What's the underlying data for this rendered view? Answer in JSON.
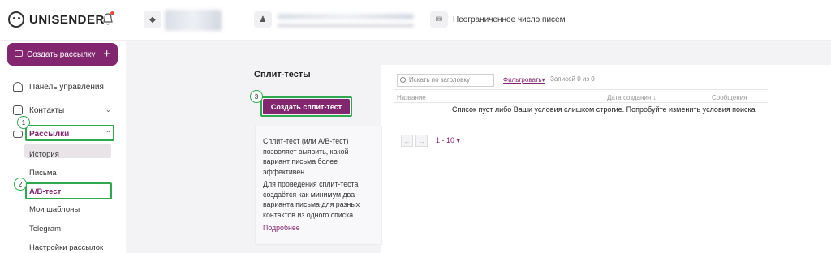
{
  "brand": {
    "name": "UNISENDER"
  },
  "topbar": {
    "plan_text": "Неограниченное число писем"
  },
  "sidebar": {
    "create_label": "Создать рассылку",
    "create_plus": "+",
    "items": [
      {
        "label": "Панель управления",
        "icon": "dashboard-icon"
      },
      {
        "label": "Контакты",
        "icon": "contacts-icon"
      },
      {
        "label": "Рассылки",
        "icon": "mail-icon"
      }
    ],
    "subitems": [
      "История",
      "Письма",
      "A/B-тест",
      "Мои шаблоны",
      "Telegram",
      "Настройки рассылок"
    ]
  },
  "annotations": {
    "step1": "1",
    "step2": "2",
    "step3": "3",
    "highlight_color": "#2fa84f"
  },
  "main": {
    "title": "Сплит-тесты",
    "create_split_label": "Создать сплит-тест",
    "info_p1": "Сплит-тест (или A/B-тест) позволяет выявить, какой вариант письма более эффективен.",
    "info_p2": "Для проведения сплит-теста создаётся как минимум два варианта письма для разных контактов из одного списка.",
    "more_link": "Подробнее",
    "search_placeholder": "Искать по заголовку",
    "filter_label": "Фильтровать",
    "records_label": "Записей 0 из 0",
    "columns": [
      "Название",
      "Дата создания ↓",
      "Сообщения"
    ],
    "empty_message": "Список пуст либо Ваши условия слишком строгие. Попробуйте изменить условия поиска",
    "pagination": {
      "prev": "←",
      "next": "→",
      "range": "1 - 10"
    }
  },
  "colors": {
    "accent": "#82276f",
    "sidebar_active_bg": "#e9e4e8"
  }
}
